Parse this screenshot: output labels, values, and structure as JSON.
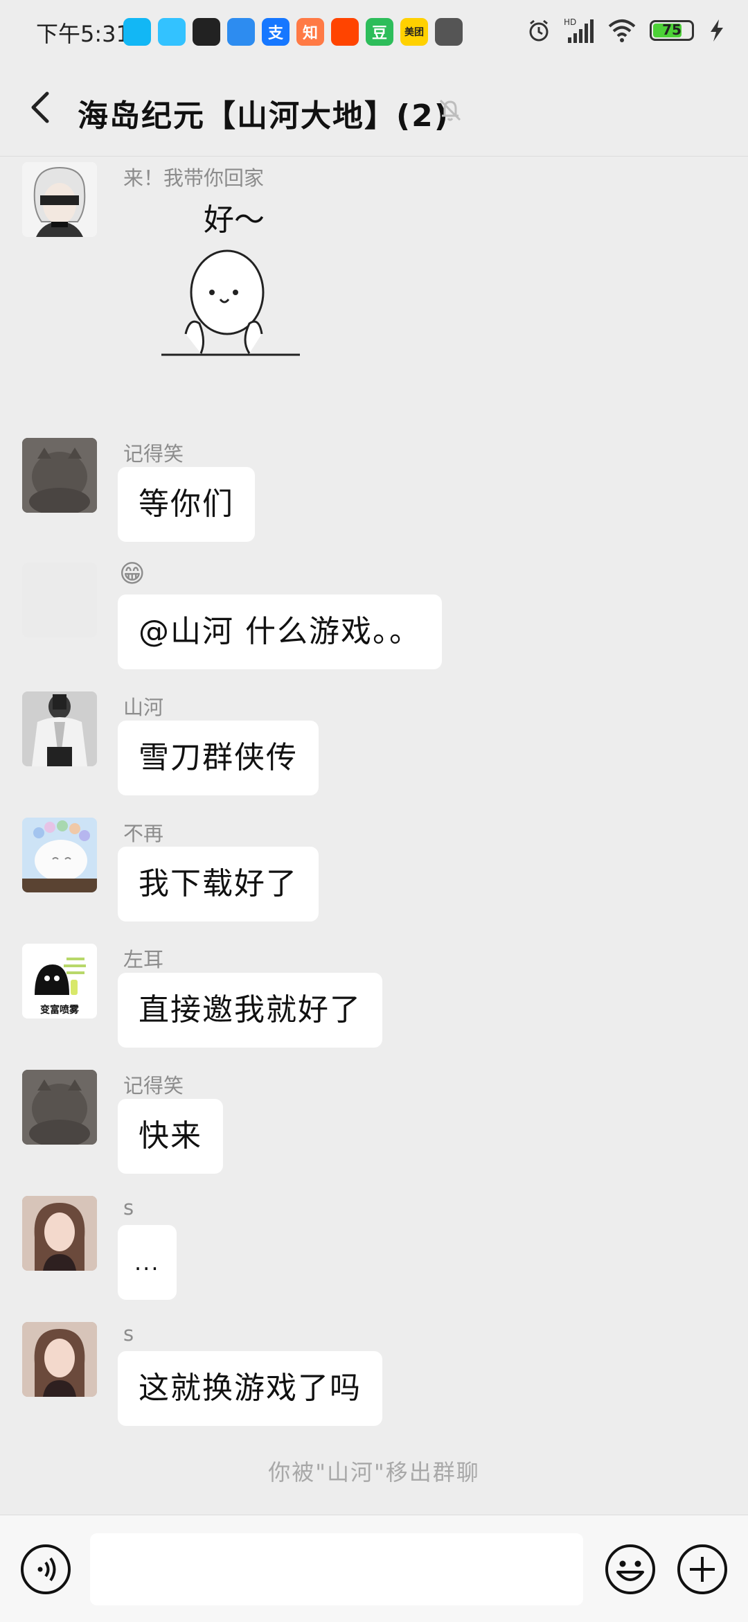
{
  "status_bar": {
    "time": "下午5:31",
    "app_icons": [
      {
        "name": "qq-icon",
        "label": "",
        "color": "#12b7f5"
      },
      {
        "name": "qq-lite-icon",
        "label": "",
        "color": "#33c2ff"
      },
      {
        "name": "app-icon",
        "label": "",
        "color": "#222222"
      },
      {
        "name": "baidu-netdisk-icon",
        "label": "",
        "color": "#2d8cf0"
      },
      {
        "name": "alipay-icon",
        "label": "支",
        "color": "#1677ff"
      },
      {
        "name": "zhihu-icon",
        "label": "知",
        "color": "#ff7a45"
      },
      {
        "name": "taobao-icon",
        "label": "",
        "color": "#ff4400"
      },
      {
        "name": "douban-icon",
        "label": "豆",
        "color": "#2dbd5a"
      },
      {
        "name": "meituan-icon",
        "label": "美团",
        "color": "#ffd100"
      },
      {
        "name": "blocked-icon",
        "label": "",
        "color": "#555555"
      }
    ],
    "battery_level": "75"
  },
  "header": {
    "title": "海岛纪元【山河大地】(2)"
  },
  "messages": [
    {
      "sender": "来！我带你回家",
      "type": "sticker",
      "sticker_text": "好～"
    },
    {
      "sender": "记得笑",
      "text": "等你们"
    },
    {
      "sender": "😁",
      "text": "@山河  什么游戏。。"
    },
    {
      "sender": "山河",
      "text": "雪刀群侠传"
    },
    {
      "sender": "不再",
      "text": "我下载好了"
    },
    {
      "sender": "左耳",
      "text": "直接邀我就好了",
      "avatar_text": "变富喷雾"
    },
    {
      "sender": "记得笑",
      "text": "快来"
    },
    {
      "sender": "s",
      "text": "..."
    },
    {
      "sender": "s",
      "text": "这就换游戏了吗"
    }
  ],
  "system_note": "你被\"山河\"移出群聊",
  "input_bar": {
    "placeholder": ""
  }
}
